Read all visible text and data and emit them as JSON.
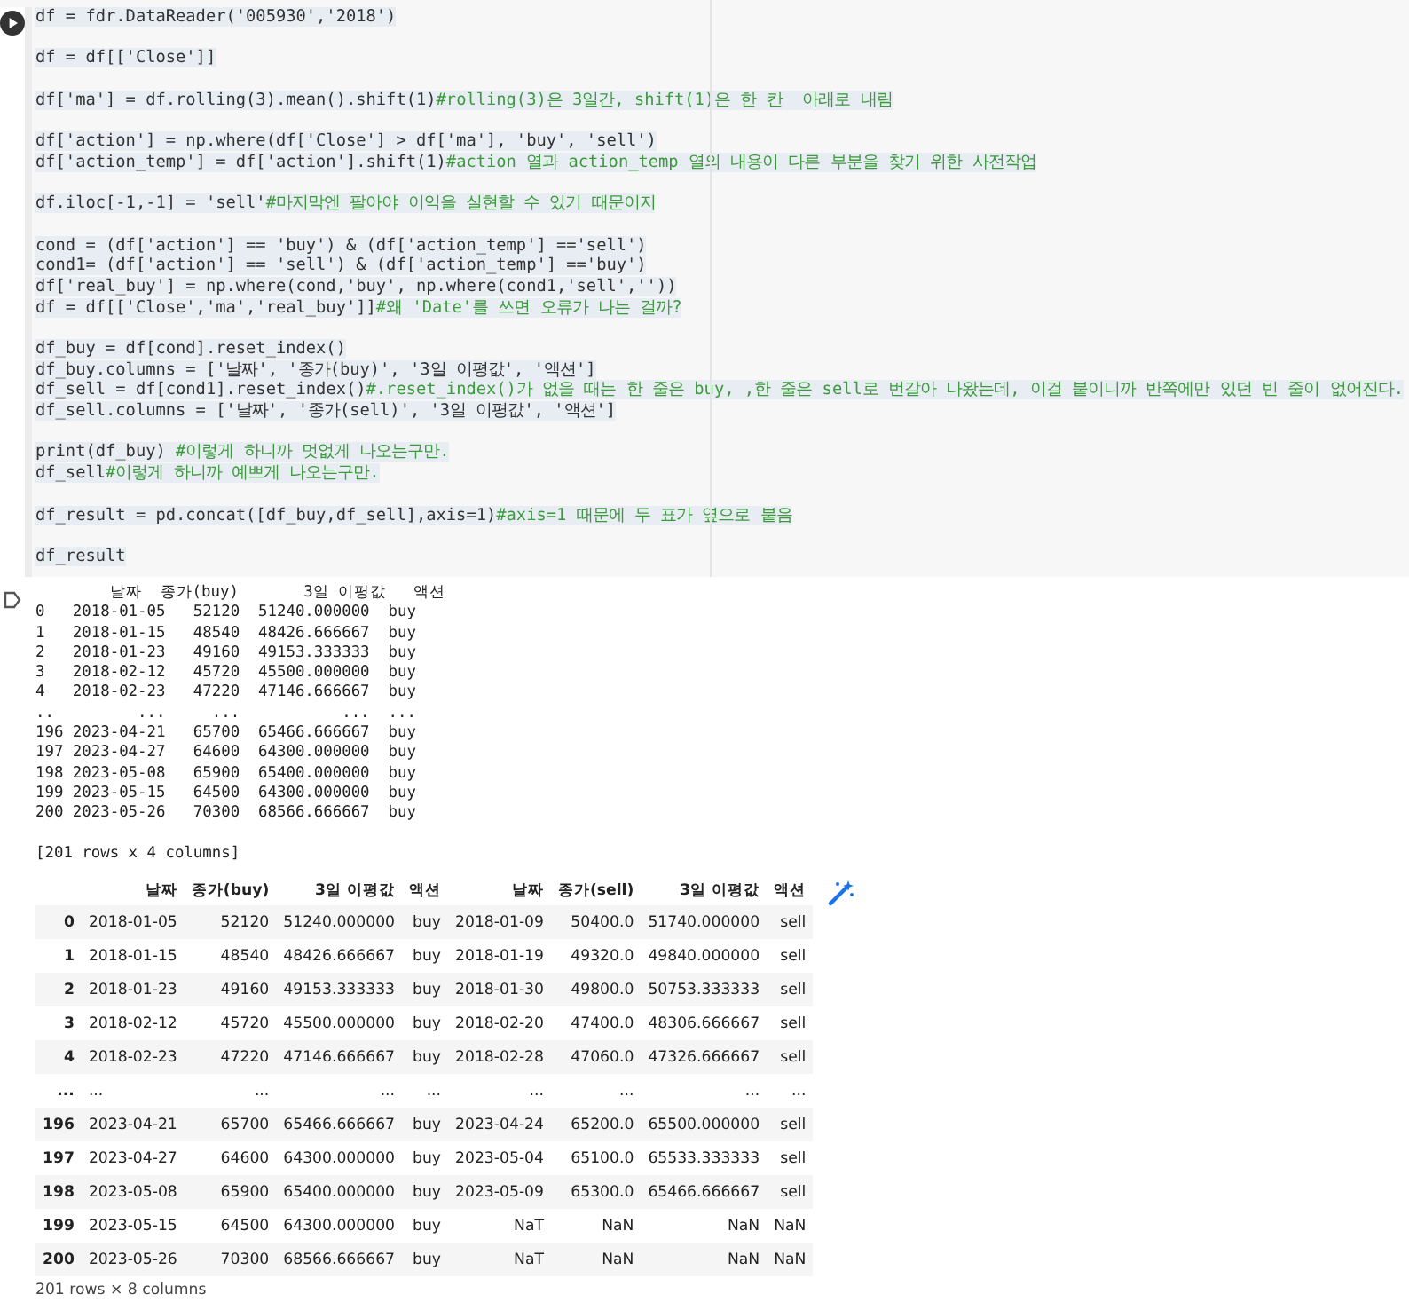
{
  "code_cell": {
    "lines": [
      {
        "kind": "code",
        "code": "df = fdr.DataReader('005930','2018')"
      },
      {
        "kind": "blank"
      },
      {
        "kind": "code",
        "code": "df = df[['Close']]"
      },
      {
        "kind": "blank"
      },
      {
        "kind": "code",
        "code": "df['ma'] = df.rolling(3).mean().shift(1)",
        "comment": "#rolling(3)은 3일간, shift(1)은 한 칸  아래로 내림"
      },
      {
        "kind": "blank"
      },
      {
        "kind": "code",
        "code": "df['action'] = np.where(df['Close'] > df['ma'], 'buy', 'sell')"
      },
      {
        "kind": "code",
        "code": "df['action_temp'] = df['action'].shift(1)",
        "comment": "#action 열과 action_temp 열의 내용이 다른 부분을 찾기 위한 사전작업"
      },
      {
        "kind": "blank"
      },
      {
        "kind": "code",
        "code": "df.iloc[-1,-1] = 'sell'",
        "comment": "#마지막엔 팔아야 이익을 실현할 수 있기 때문이지"
      },
      {
        "kind": "blank"
      },
      {
        "kind": "code",
        "code": "cond = (df['action'] == 'buy') & (df['action_temp'] =='sell')"
      },
      {
        "kind": "code",
        "code": "cond1= (df['action'] == 'sell') & (df['action_temp'] =='buy')"
      },
      {
        "kind": "code",
        "code": "df['real_buy'] = np.where(cond,'buy', np.where(cond1,'sell',''))"
      },
      {
        "kind": "code",
        "code": "df = df[['Close','ma','real_buy']]",
        "comment": "#왜 'Date'를 쓰면 오류가 나는 걸까?"
      },
      {
        "kind": "blank"
      },
      {
        "kind": "code",
        "code": "df_buy = df[cond].reset_index()"
      },
      {
        "kind": "code",
        "code": "df_buy.columns = ['날짜', '종가(buy)', '3일 이평값', '액션']"
      },
      {
        "kind": "code",
        "code": "df_sell = df[cond1].reset_index()",
        "comment": "#.reset_index()가 없을 때는 한 줄은 buy, ,한 줄은 sell로 번갈아 나왔는데, 이걸 붙이니까 반쪽에만 있던 빈 줄이 없어진다."
      },
      {
        "kind": "code",
        "code": "df_sell.columns = ['날짜', '종가(sell)', '3일 이평값', '액션']"
      },
      {
        "kind": "blank"
      },
      {
        "kind": "code",
        "code": "print(df_buy) ",
        "comment": "#이렇게 하니까 멋없게 나오는구만."
      },
      {
        "kind": "code",
        "code": "df_sell",
        "comment": "#이렇게 하니까 예쁘게 나오는구만."
      },
      {
        "kind": "blank"
      },
      {
        "kind": "code",
        "code": "df_result = pd.concat([df_buy,df_sell],axis=1)",
        "comment": "#axis=1 때문에 두 표가 옆으로 붙음"
      },
      {
        "kind": "blank"
      },
      {
        "kind": "code",
        "code": "df_result"
      }
    ]
  },
  "print_output": {
    "lines": [
      "        날짜  종가(buy)       3일 이평값   액션",
      "0   2018-01-05   52120  51240.000000  buy",
      "1   2018-01-15   48540  48426.666667  buy",
      "2   2018-01-23   49160  49153.333333  buy",
      "3   2018-02-12   45720  45500.000000  buy",
      "4   2018-02-23   47220  47146.666667  buy",
      "..         ...     ...           ...  ...",
      "196 2023-04-21   65700  65466.666667  buy",
      "197 2023-04-27   64600  64300.000000  buy",
      "198 2023-05-08   65900  65400.000000  buy",
      "199 2023-05-15   64500  64300.000000  buy",
      "200 2023-05-26   70300  68566.666667  buy",
      {
        "kind": "blank"
      },
      "[201 rows x 4 columns]"
    ]
  },
  "table": {
    "columns": [
      "",
      "날짜",
      "종가(buy)",
      "3일 이평값",
      "액션",
      "날짜",
      "종가(sell)",
      "3일 이평값",
      "액션"
    ],
    "rows": [
      [
        "0",
        "2018-01-05",
        "52120",
        "51240.000000",
        "buy",
        "2018-01-09",
        "50400.0",
        "51740.000000",
        "sell"
      ],
      [
        "1",
        "2018-01-15",
        "48540",
        "48426.666667",
        "buy",
        "2018-01-19",
        "49320.0",
        "49840.000000",
        "sell"
      ],
      [
        "2",
        "2018-01-23",
        "49160",
        "49153.333333",
        "buy",
        "2018-01-30",
        "49800.0",
        "50753.333333",
        "sell"
      ],
      [
        "3",
        "2018-02-12",
        "45720",
        "45500.000000",
        "buy",
        "2018-02-20",
        "47400.0",
        "48306.666667",
        "sell"
      ],
      [
        "4",
        "2018-02-23",
        "47220",
        "47146.666667",
        "buy",
        "2018-02-28",
        "47060.0",
        "47326.666667",
        "sell"
      ],
      [
        "...",
        "...",
        "...",
        "...",
        "...",
        "...",
        "...",
        "...",
        "..."
      ],
      [
        "196",
        "2023-04-21",
        "65700",
        "65466.666667",
        "buy",
        "2023-04-24",
        "65200.0",
        "65500.000000",
        "sell"
      ],
      [
        "197",
        "2023-04-27",
        "64600",
        "64300.000000",
        "buy",
        "2023-05-04",
        "65100.0",
        "65533.333333",
        "sell"
      ],
      [
        "198",
        "2023-05-08",
        "65900",
        "65400.000000",
        "buy",
        "2023-05-09",
        "65300.0",
        "65466.666667",
        "sell"
      ],
      [
        "199",
        "2023-05-15",
        "64500",
        "64300.000000",
        "buy",
        "NaT",
        "NaN",
        "NaN",
        "NaN"
      ],
      [
        "200",
        "2023-05-26",
        "70300",
        "68566.666667",
        "buy",
        "NaT",
        "NaN",
        "NaN",
        "NaN"
      ]
    ],
    "footer": "201 rows × 8 columns"
  }
}
